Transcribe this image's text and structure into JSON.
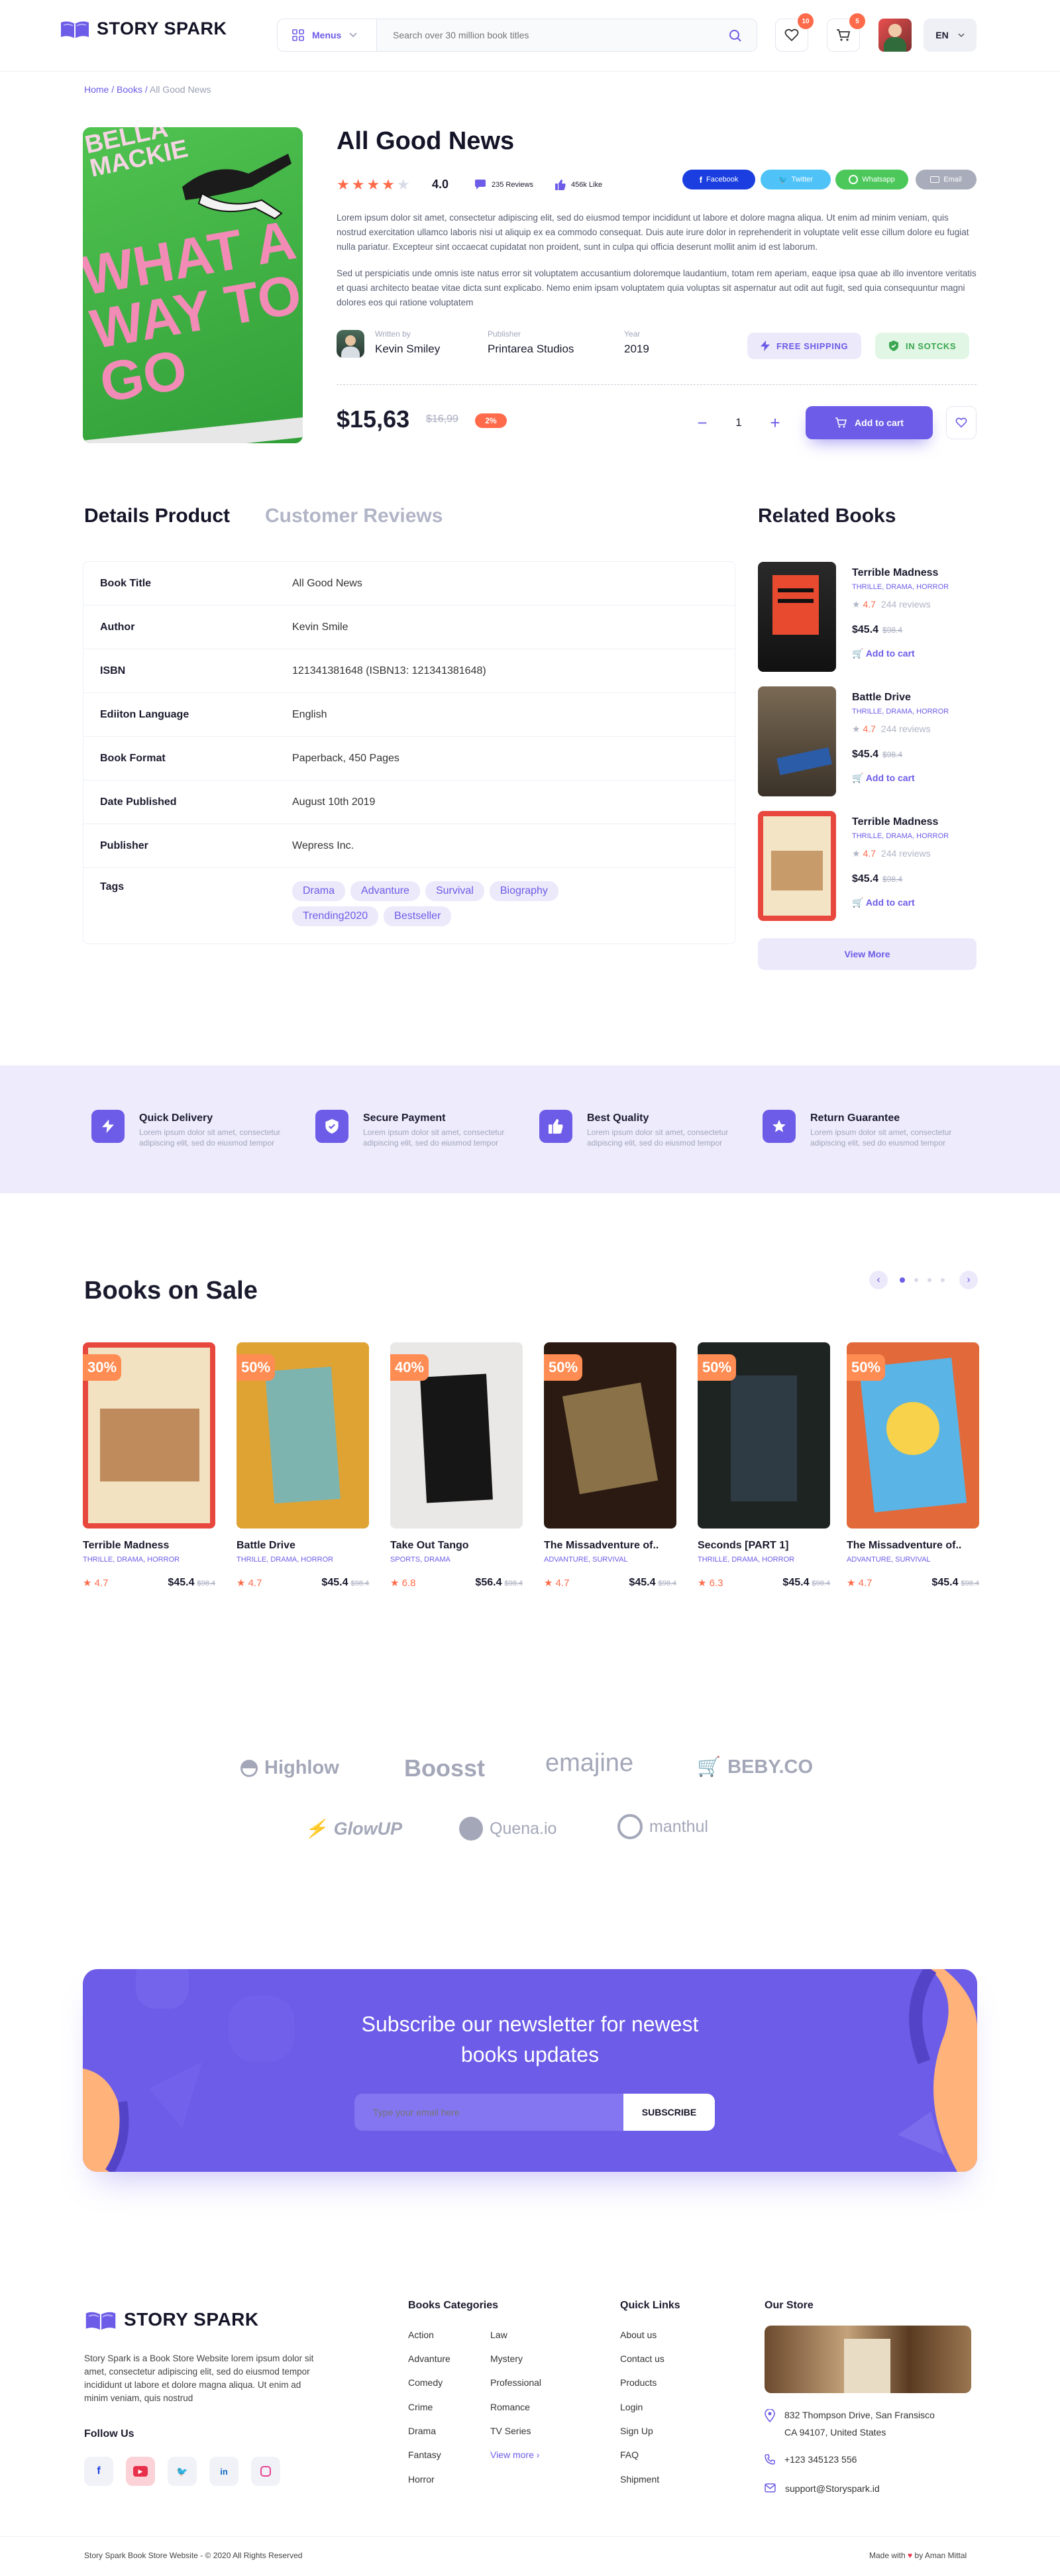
{
  "brand": {
    "name": "STORY SPARK"
  },
  "header": {
    "menus_label": "Menus",
    "search_placeholder": "Search over 30 million book titles",
    "wishlist_count": "10",
    "cart_count": "5",
    "language": "EN"
  },
  "breadcrumb": {
    "home": "Home",
    "books": "Books",
    "current": "All Good News"
  },
  "product": {
    "title": "All Good News",
    "rating": "4.0",
    "reviews": "235 Reviews",
    "likes": "456k Like",
    "share": {
      "facebook": "Facebook",
      "twitter": "Twitter",
      "whatsapp": "Whatsapp",
      "email": "Email"
    },
    "desc1": "Lorem ipsum dolor sit amet, consectetur adipiscing elit, sed do eiusmod tempor incididunt ut labore et dolore magna aliqua. Ut enim ad minim veniam, quis nostrud exercitation ullamco laboris nisi ut aliquip ex ea commodo consequat. Duis aute irure dolor in reprehenderit in voluptate velit esse cillum dolore eu fugiat nulla pariatur. Excepteur sint occaecat cupidatat non proident, sunt in culpa qui officia deserunt mollit anim id est laborum.",
    "desc2": "Sed ut perspiciatis unde omnis iste natus error sit voluptatem accusantium doloremque laudantium, totam rem aperiam, eaque ipsa quae ab illo inventore veritatis et quasi architecto beatae vitae dicta sunt explicabo. Nemo enim ipsam voluptatem quia voluptas sit aspernatur aut odit aut fugit, sed quia consequuntur magni dolores eos qui ratione voluptatem",
    "written_by_label": "Written by",
    "author": "Kevin Smiley",
    "publisher_label": "Publisher",
    "publisher": "Printarea Studios",
    "year_label": "Year",
    "year": "2019",
    "free_shipping": "FREE SHIPPING",
    "in_stock": "IN SOTCKS",
    "price": "$15,63",
    "old_price": "$16,99",
    "discount": "2%",
    "quantity": "1",
    "add_to_cart": "Add to cart",
    "cover": {
      "line1": "BELLA",
      "line2": "MACKIE",
      "big": "WHAT A WAY TO GO"
    }
  },
  "tabs": {
    "details": "Details Product",
    "reviews": "Customer Reviews"
  },
  "details": [
    {
      "k": "Book Title",
      "v": "All Good News"
    },
    {
      "k": "Author",
      "v": "Kevin Smile"
    },
    {
      "k": "ISBN",
      "v": "121341381648 (ISBN13: 121341381648)"
    },
    {
      "k": "Ediiton Language",
      "v": "English"
    },
    {
      "k": "Book Format",
      "v": "Paperback, 450 Pages"
    },
    {
      "k": "Date Published",
      "v": "August 10th 2019"
    },
    {
      "k": "Publisher",
      "v": "Wepress Inc."
    }
  ],
  "tags_label": "Tags",
  "tags": [
    "Drama",
    "Advanture",
    "Survival",
    "Biography",
    "Trending2020",
    "Bestseller"
  ],
  "related": {
    "heading": "Related Books",
    "view_more": "View More",
    "items": [
      {
        "title": "Terrible Madness",
        "cats": "THRILLE, DRAMA, HORROR",
        "rating": "4.7",
        "reviews": "244 reviews",
        "price": "$45.4",
        "old": "$98.4",
        "add": "Add to cart"
      },
      {
        "title": "Battle Drive",
        "cats": "THRILLE, DRAMA, HORROR",
        "rating": "4.7",
        "reviews": "244 reviews",
        "price": "$45.4",
        "old": "$98.4",
        "add": "Add to cart"
      },
      {
        "title": "Terrible Madness",
        "cats": "THRILLE, DRAMA, HORROR",
        "rating": "4.7",
        "reviews": "244 reviews",
        "price": "$45.4",
        "old": "$98.4",
        "add": "Add to cart"
      }
    ]
  },
  "features": [
    {
      "title": "Quick Delivery",
      "desc": "Lorem ipsum dolor sit amet, consectetur adipiscing elit, sed do eiusmod tempor"
    },
    {
      "title": "Secure Payment",
      "desc": "Lorem ipsum dolor sit amet, consectetur adipiscing elit, sed do eiusmod tempor"
    },
    {
      "title": "Best Quality",
      "desc": "Lorem ipsum dolor sit amet, consectetur adipiscing elit, sed do eiusmod tempor"
    },
    {
      "title": "Return Guarantee",
      "desc": "Lorem ipsum dolor sit amet, consectetur adipiscing elit, sed do eiusmod tempor"
    }
  ],
  "sale": {
    "heading": "Books on Sale",
    "items": [
      {
        "disc": "30%",
        "title": "Terrible Madness",
        "cats": "THRILLE, DRAMA, HORROR",
        "rating": "4.7",
        "price": "$45.4",
        "old": "$98.4"
      },
      {
        "disc": "50%",
        "title": "Battle Drive",
        "cats": "THRILLE, DRAMA, HORROR",
        "rating": "4.7",
        "price": "$45.4",
        "old": "$98.4"
      },
      {
        "disc": "40%",
        "title": "Take Out Tango",
        "cats": "SPORTS, DRAMA",
        "rating": "6.8",
        "price": "$56.4",
        "old": "$98.4"
      },
      {
        "disc": "50%",
        "title": "The Missadventure of..",
        "cats": "ADVANTURE, SURVIVAL",
        "rating": "4.7",
        "price": "$45.4",
        "old": "$98.4"
      },
      {
        "disc": "50%",
        "title": "Seconds [PART 1]",
        "cats": "THRILLE, DRAMA, HORROR",
        "rating": "6.3",
        "price": "$45.4",
        "old": "$98.4"
      },
      {
        "disc": "50%",
        "title": "The Missadventure of..",
        "cats": "ADVANTURE, SURVIVAL",
        "rating": "4.7",
        "price": "$45.4",
        "old": "$98.4"
      }
    ]
  },
  "partners": [
    "Highlow",
    "Boosst",
    "emajine",
    "BEBY.CO",
    "GlowUP",
    "Quena.io",
    "manthul"
  ],
  "newsletter": {
    "title_line1": "Subscribe our newsletter for newest",
    "title_line2": "books updates",
    "placeholder": "Type your email here",
    "button": "SUBSCRIBE"
  },
  "footer": {
    "about": "Story Spark is a Book Store Website lorem ipsum dolor sit amet, consectetur adipiscing elit, sed do eiusmod tempor incididunt ut labore et dolore magna aliqua. Ut enim ad minim veniam, quis nostrud",
    "follow": "Follow Us",
    "categories_heading": "Books Categories",
    "categories_col1": [
      "Action",
      "Advanture",
      "Comedy",
      "Crime",
      "Drama",
      "Fantasy",
      "Horror"
    ],
    "categories_col2": [
      "Law",
      "Mystery",
      "Professional",
      "Romance",
      "TV Series"
    ],
    "view_more": "View more",
    "quick_heading": "Quick Links",
    "quick": [
      "About us",
      "Contact us",
      "Products",
      "Login",
      "Sign Up",
      "FAQ",
      "Shipment"
    ],
    "store_heading": "Our Store",
    "address1": "832  Thompson Drive, San Fransisco",
    "address2": "CA 94107, United States",
    "phone": "+123 345123 556",
    "email": "support@Storyspark.id",
    "copyright": "Story Spark Book Store Website  -  © 2020 All Rights Reserved",
    "made_with": "Made with",
    "by": "by Aman Mittal"
  },
  "colors": {
    "accent": "#6c5ce7",
    "orange": "#ff6b4a"
  }
}
